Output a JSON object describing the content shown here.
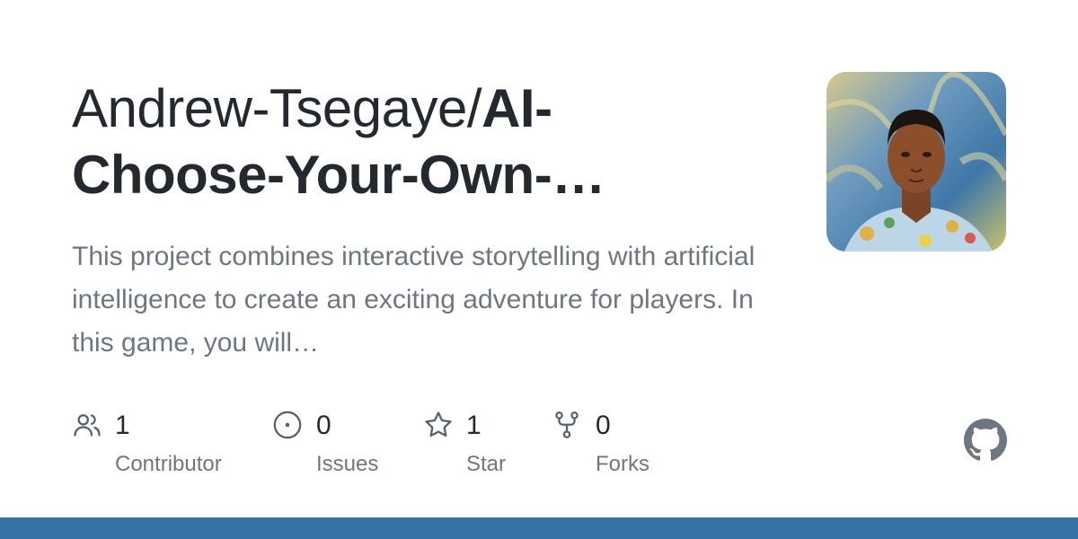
{
  "repo": {
    "owner_part": "Andrew-Tsegaye/",
    "name_line1": "AI-",
    "name_line2": "Choose-Your-Own-…",
    "description": "This project combines interactive storytelling with artificial intelligence to create an exciting adventure for players. In this game, you will…"
  },
  "stats": [
    {
      "icon": "people-icon",
      "count": "1",
      "label": "Contributor"
    },
    {
      "icon": "issue-opened-icon",
      "count": "0",
      "label": "Issues"
    },
    {
      "icon": "star-icon",
      "count": "1",
      "label": "Star"
    },
    {
      "icon": "repo-forked-icon",
      "count": "0",
      "label": "Forks"
    }
  ],
  "colors": {
    "title": "#24292f",
    "muted": "#6e7781",
    "icon": "#57606a",
    "logo": "#6e7781",
    "bar": "#3572A5"
  }
}
